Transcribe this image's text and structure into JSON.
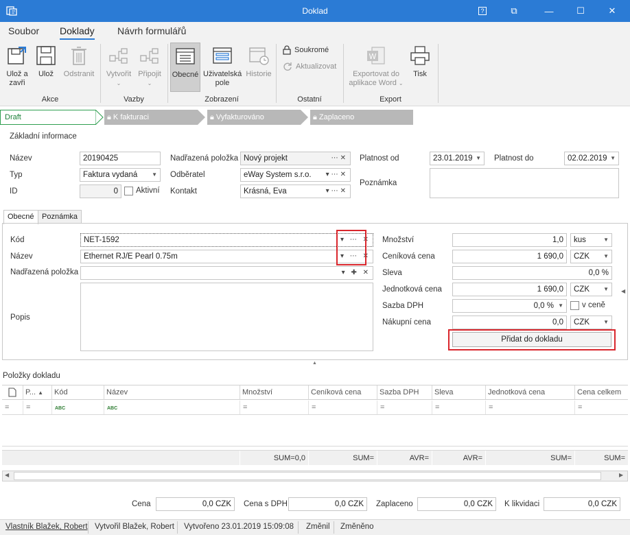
{
  "window": {
    "title": "Doklad",
    "help": "?",
    "restore_icon": "⧉",
    "minimize": "—",
    "maximize": "☐",
    "close": "✕"
  },
  "menu": {
    "items": [
      "Soubor",
      "Doklady",
      "Návrh formulářů"
    ]
  },
  "ribbon": {
    "akce": {
      "label": "Akce",
      "save_close": [
        "Ulož a",
        "zavři"
      ],
      "save": "Ulož",
      "delete": "Odstranit"
    },
    "vazby": {
      "label": "Vazby",
      "create": "Vytvořit",
      "attach": "Připojit"
    },
    "zobrazeni": {
      "label": "Zobrazení",
      "general": "Obecné",
      "user_fields": [
        "Uživatelská",
        "pole"
      ],
      "history": "Historie"
    },
    "ostatni": {
      "label": "Ostatní",
      "private": "Soukromé",
      "refresh": "Aktualizovat"
    },
    "export": {
      "label": "Export",
      "word": [
        "Exportovat do",
        "aplikace Word"
      ],
      "print": "Tisk"
    }
  },
  "flow": {
    "steps": [
      "Draft",
      "K fakturaci",
      "Vyfakturováno",
      "Zaplaceno"
    ]
  },
  "basic": {
    "section_title": "Základní informace",
    "name_label": "Název",
    "name_value": "20190425",
    "type_label": "Typ",
    "type_value": "Faktura vydaná",
    "id_label": "ID",
    "id_value": "0",
    "active_label": "Aktivní",
    "parent_label": "Nadřazená položka",
    "parent_value": "Nový projekt",
    "customer_label": "Odběratel",
    "customer_value": "eWay System s.r.o.",
    "contact_label": "Kontakt",
    "contact_value": "Krásná, Eva",
    "valid_from_label": "Platnost od",
    "valid_from_value": "23.01.2019",
    "valid_to_label": "Platnost do",
    "valid_to_value": "02.02.2019",
    "note_label": "Poznámka"
  },
  "tabs": [
    "Obecné",
    "Poznámka"
  ],
  "item": {
    "code_label": "Kód",
    "code_value": "NET-1592",
    "name_label": "Název",
    "name_value": "Ethernet RJ/E Pearl 0.75m",
    "parent_label": "Nadřazená položka",
    "desc_label": "Popis",
    "qty_label": "Množství",
    "qty_value": "1,0",
    "qty_unit": "kus",
    "list_price_label": "Ceníková cena",
    "list_price_value": "1 690,0",
    "list_price_cur": "CZK",
    "discount_label": "Sleva",
    "discount_value": "0,0 %",
    "unit_price_label": "Jednotková cena",
    "unit_price_value": "1 690,0",
    "unit_price_cur": "CZK",
    "vat_label": "Sazba DPH",
    "vat_value": "0,0 %",
    "vat_incl_label": "v ceně",
    "purchase_label": "Nákupní cena",
    "purchase_value": "0,0",
    "purchase_cur": "CZK",
    "add_button": "Přidat do dokladu"
  },
  "grid": {
    "title": "Položky dokladu",
    "columns": [
      "P...",
      "Kód",
      "Název",
      "Množství",
      "Ceníková cena",
      "Sazba DPH",
      "Sleva",
      "Jednotková cena",
      "Cena celkem"
    ],
    "filter_symbol": "=",
    "text_filter": "ABC",
    "sums": [
      "SUM=0,0",
      "SUM=",
      "AVR=",
      "AVR=",
      "SUM=",
      "SUM="
    ]
  },
  "totals": {
    "price_label": "Cena",
    "price_value": "0,0 CZK",
    "price_vat_label": "Cena s DPH",
    "price_vat_value": "0,0 CZK",
    "paid_label": "Zaplaceno",
    "paid_value": "0,0 CZK",
    "to_settle_label": "K likvidaci",
    "to_settle_value": "0,0 CZK"
  },
  "status": {
    "owner": "Vlastník Blažek, Robert",
    "created_by": "Vytvořil Blažek, Robert",
    "created": "Vytvořeno 23.01.2019 15:09:08",
    "changed_by": "Změnil",
    "changed": "Změněno"
  },
  "colors": {
    "titlebar": "#2b7bd5",
    "accent": "#2b7bd5",
    "draft": "#2e9e4f",
    "highlight": "#d9262c"
  }
}
